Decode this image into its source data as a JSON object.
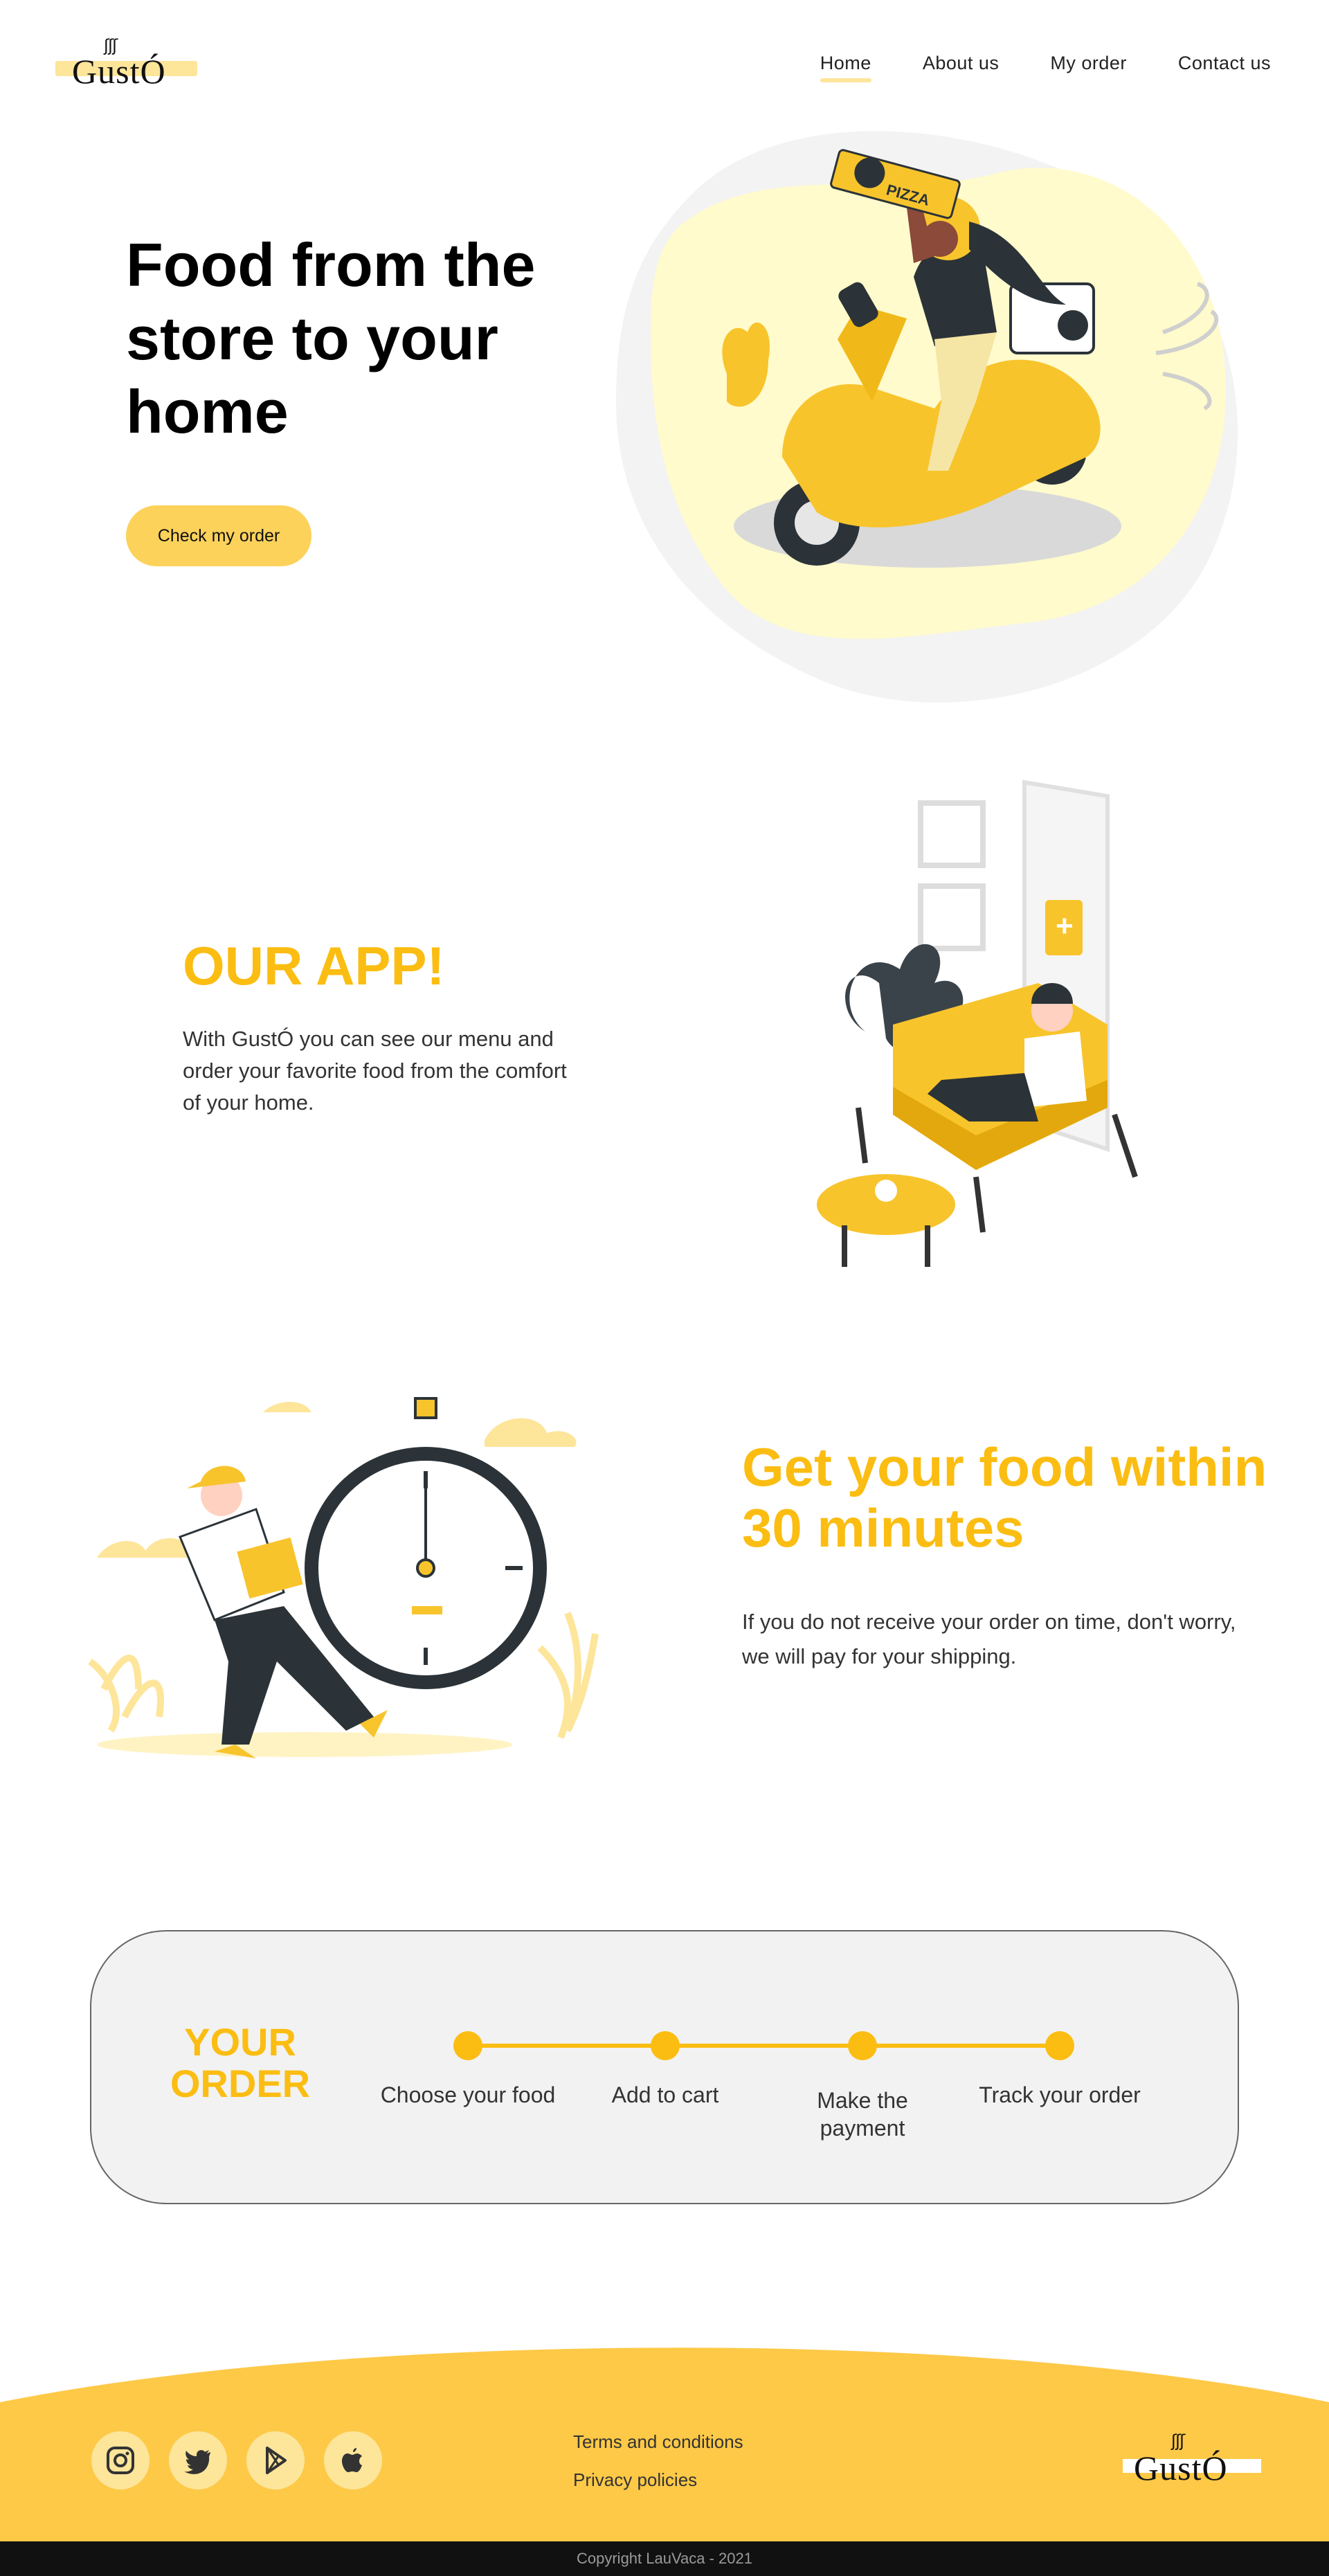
{
  "brand": {
    "logo_text": "GustÓ",
    "steam": "ʃʃʃ"
  },
  "nav": {
    "links": [
      {
        "label": "Home",
        "active": true
      },
      {
        "label": "About us",
        "active": false
      },
      {
        "label": "My order",
        "active": false
      },
      {
        "label": "Contact us",
        "active": false
      }
    ]
  },
  "hero": {
    "title": "Food from the store to your home",
    "cta_label": "Check my order",
    "illustration": "delivery-scooter-pizza",
    "pizza_box_text": "PIZZA"
  },
  "app": {
    "title": "OUR APP!",
    "text": "With GustÓ you can see our menu and order your favorite food from the comfort of your home.",
    "illustration": "person-on-sofa-with-phone"
  },
  "fast": {
    "title": "Get your food within 30 minutes",
    "text": "If you do not receive your order on time, don't worry, we will pay for your shipping.",
    "illustration": "courier-with-stopwatch"
  },
  "order": {
    "title": "YOUR ORDER",
    "steps": [
      {
        "label": "Choose your food"
      },
      {
        "label": "Add to cart"
      },
      {
        "label": "Make the payment"
      },
      {
        "label": "Track your order"
      }
    ]
  },
  "footer": {
    "social": [
      {
        "icon": "instagram-icon"
      },
      {
        "icon": "twitter-icon"
      },
      {
        "icon": "google-play-icon"
      },
      {
        "icon": "apple-icon"
      }
    ],
    "links": [
      "Terms and conditions",
      "Privacy policies"
    ],
    "copyright": "Copyright LauVaca - 2021"
  },
  "colors": {
    "accent": "#fbbd12",
    "button": "#fcd25b",
    "highlight": "#fde59a",
    "footer": "#fdc947",
    "card": "#f2f2f2"
  }
}
